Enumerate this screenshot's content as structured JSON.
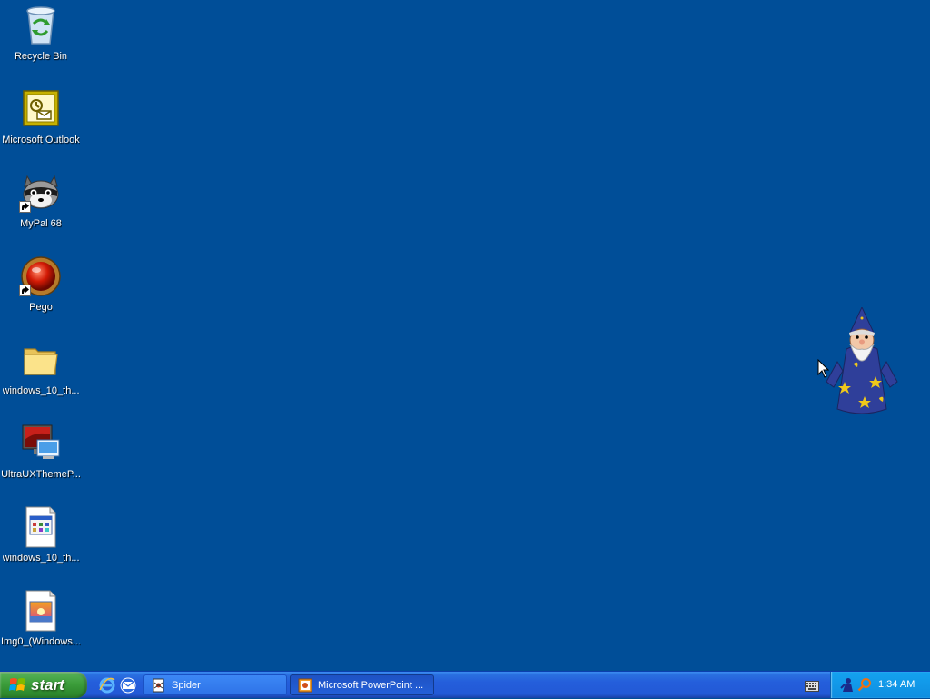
{
  "desktop": {
    "icons": [
      {
        "label": "Recycle Bin",
        "icon": "recycle-bin-icon"
      },
      {
        "label": "Microsoft Outlook",
        "icon": "outlook-icon"
      },
      {
        "label": "MyPal 68",
        "icon": "mypal-raccoon-icon",
        "shortcut": true
      },
      {
        "label": "Pego",
        "icon": "pego-red-ball-icon",
        "shortcut": true
      },
      {
        "label": "windows_10_th...",
        "icon": "folder-icon"
      },
      {
        "label": "UltraUXThemeP...",
        "icon": "display-monitor-icon"
      },
      {
        "label": "windows_10_th...",
        "icon": "document-file-icon"
      },
      {
        "label": "Img0_(Windows...",
        "icon": "image-file-icon"
      }
    ],
    "agent": "merlin-wizard-agent"
  },
  "taskbar": {
    "start_label": "start",
    "quick_launch": [
      "internet-explorer-icon",
      "outlook-express-icon"
    ],
    "tasks": [
      {
        "label": "Spider",
        "icon": "spider-solitaire-icon",
        "active": false
      },
      {
        "label": "Microsoft PowerPoint ...",
        "icon": "powerpoint-icon",
        "active": true
      }
    ],
    "tray": {
      "icons": [
        "keyboard-icon",
        "user-icon",
        "search-icon"
      ],
      "clock": "1:34 AM"
    }
  },
  "colors": {
    "desktop_bg": "#004e98",
    "taskbar": "#245edb",
    "start_button": "#3c9e3b",
    "tray": "#0f8ee0"
  }
}
